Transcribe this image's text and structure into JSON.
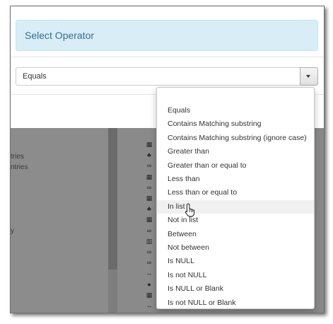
{
  "modal": {
    "title": "Select Operator",
    "close_glyph": "×"
  },
  "operator_select": {
    "value": "Equals"
  },
  "operator_menu": {
    "options": [
      "Equals",
      "Contains Matching substring",
      "Contains Matching substring (ignore case)",
      "Greater than",
      "Greater than or equal to",
      "Less than",
      "Less than or equal to",
      "In list",
      "Not in list",
      "Between",
      "Not between",
      "Is NULL",
      "Is not NULL",
      "Is NULL or Blank",
      "Is not NULL or Blank"
    ],
    "hovered": "In list"
  },
  "background": {
    "entries": [
      "tries",
      "ntries",
      "y"
    ],
    "column_icons": [
      "calendar-icon",
      "tree-icon",
      "link-icon",
      "calendar-icon",
      "link-icon",
      "calendar-icon",
      "tree-icon",
      "calendar-icon",
      "link-icon",
      "barcode-icon",
      "link-icon",
      "link-icon",
      "arrows-icon",
      "shield-icon",
      "calendar-icon",
      "arrows-icon",
      "calendar-icon",
      "text-icon"
    ],
    "column_glyphs": [
      "▦",
      "♣",
      "∞",
      "▦",
      "∞",
      "▦",
      "♣",
      "▦",
      "∞",
      "▥",
      "∞",
      "∞",
      "↔",
      "●",
      "▦",
      "↔",
      "▦",
      "A"
    ]
  },
  "colors": {
    "alert_bg": "#d9edf7",
    "alert_text": "#31708f",
    "overlay": "#8a8a8a",
    "accent": "#b77a20"
  }
}
